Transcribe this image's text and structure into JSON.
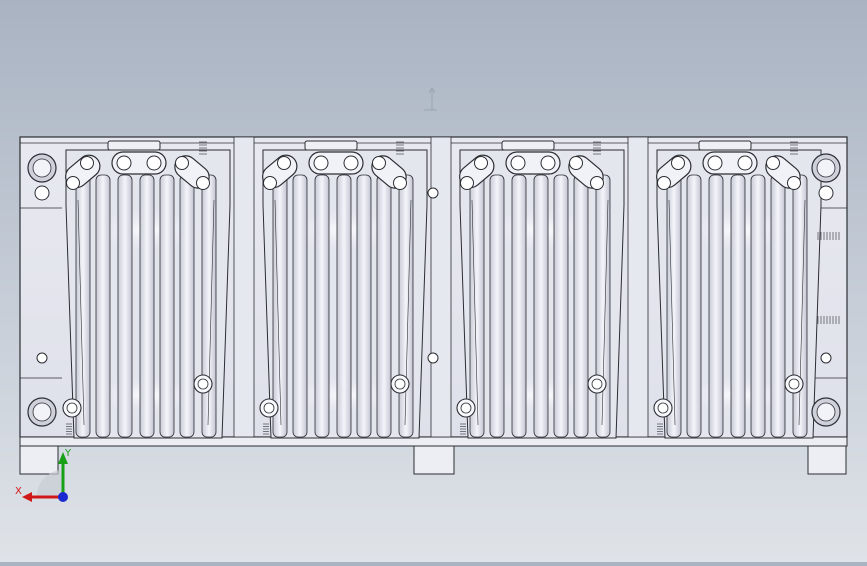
{
  "viewport": {
    "background_top": "#a9b3c2",
    "background_bottom": "#dfe3e8",
    "model_outline_color": "#2b2e33",
    "model_fill_color": "#e4e6ee",
    "cavity_highlight_color": "#f3f4ff"
  },
  "model": {
    "name": "mold-cavity-plate",
    "cavity_count": 4
  },
  "triad": {
    "x_label": "X",
    "y_label": "Y",
    "x_color": "#d01818",
    "y_color": "#18a018",
    "z_color": "#1a2ad0"
  },
  "origin_marker": {
    "icon": "origin-icon"
  }
}
